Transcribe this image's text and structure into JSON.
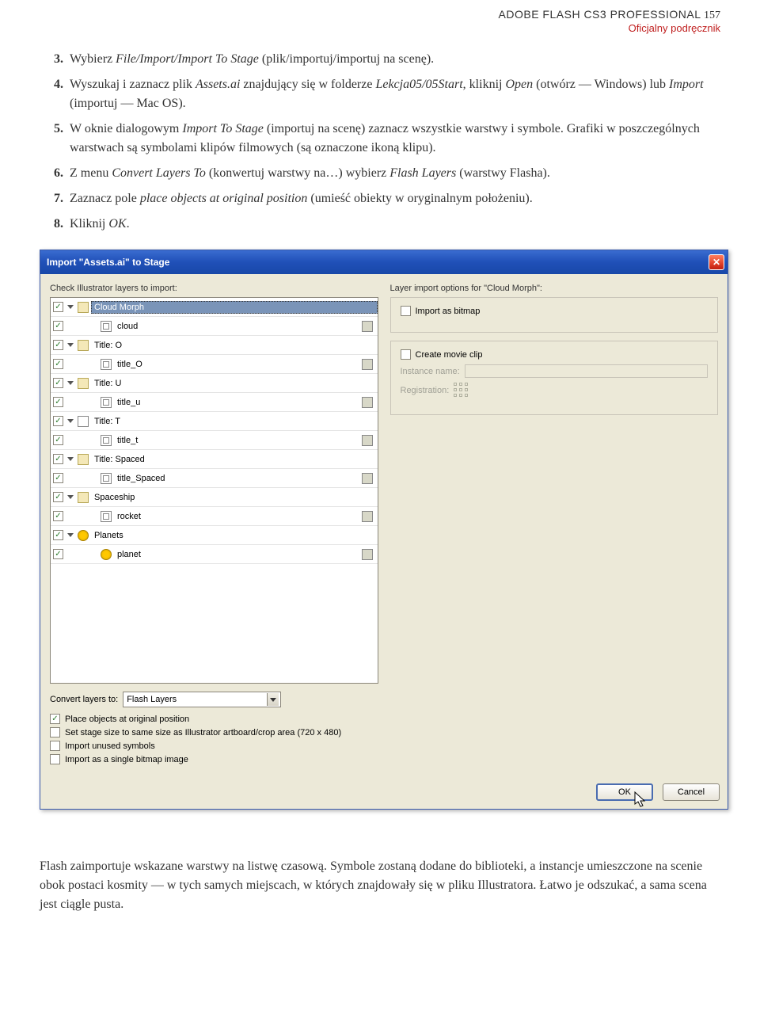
{
  "header": {
    "title": "ADOBE FLASH CS3 PROFESSIONAL",
    "page_num": "157",
    "subtitle": "Oficjalny podręcznik"
  },
  "steps": [
    {
      "n": "3.",
      "pre": "Wybierz ",
      "i": "File/Import/Import To Stage",
      "post": " (plik/importuj/importuj na scenę)."
    },
    {
      "n": "4.",
      "pre": "Wyszukaj i zaznacz plik ",
      "i": "Assets.ai",
      "post": " znajdujący się w folderze ",
      "i2": "Lekcja05/05Start",
      "post2": ", kliknij ",
      "i3": "Open",
      "post3": " (otwórz — Windows) lub ",
      "i4": "Import",
      "post4": " (importuj — Mac OS)."
    },
    {
      "n": "5.",
      "pre": "W oknie dialogowym ",
      "i": "Import To Stage",
      "post": " (importuj na scenę) zaznacz wszystkie warstwy i symbole. Grafiki w poszczególnych warstwach są symbolami klipów filmowych (są oznaczone ikoną klipu)."
    },
    {
      "n": "6.",
      "pre": "Z menu ",
      "i": "Convert Layers To",
      "post": " (konwertuj warstwy na…) wybierz ",
      "i2": "Flash Layers",
      "post2": " (warstwy Flasha)."
    },
    {
      "n": "7.",
      "pre": "Zaznacz pole ",
      "i": "place objects at original position",
      "post": " (umieść obiekty w oryginalnym położeniu)."
    },
    {
      "n": "8.",
      "pre": "Kliknij ",
      "i": "OK",
      "post": "."
    }
  ],
  "dialog": {
    "title": "Import \"Assets.ai\" to Stage",
    "left_label": "Check Illustrator layers to import:",
    "right_label": "Layer import options for \"Cloud Morph\":",
    "layers": [
      {
        "indent": 0,
        "selected": true,
        "icon": "folder",
        "label": "Cloud Morph",
        "type": null,
        "tri": true
      },
      {
        "indent": 1,
        "selected": false,
        "icon": "clip",
        "label": "cloud",
        "type": "bmp",
        "tri": false
      },
      {
        "indent": 0,
        "selected": false,
        "icon": "folder",
        "label": "Title: O",
        "type": null,
        "tri": true
      },
      {
        "indent": 1,
        "selected": false,
        "icon": "clip",
        "label": "title_O",
        "type": "bmp",
        "tri": false
      },
      {
        "indent": 0,
        "selected": false,
        "icon": "folder",
        "label": "Title: U",
        "type": null,
        "tri": true
      },
      {
        "indent": 1,
        "selected": false,
        "icon": "clip",
        "label": "title_u",
        "type": "bmp",
        "tri": false
      },
      {
        "indent": 0,
        "selected": false,
        "icon": "group",
        "label": "Title: T",
        "type": null,
        "tri": true
      },
      {
        "indent": 1,
        "selected": false,
        "icon": "clip",
        "label": "title_t",
        "type": "bmp",
        "tri": false
      },
      {
        "indent": 0,
        "selected": false,
        "icon": "folder",
        "label": "Title: Spaced",
        "type": null,
        "tri": true
      },
      {
        "indent": 1,
        "selected": false,
        "icon": "clip",
        "label": "title_Spaced",
        "type": "bmp",
        "tri": false
      },
      {
        "indent": 0,
        "selected": false,
        "icon": "folder",
        "label": "Spaceship",
        "type": null,
        "tri": true
      },
      {
        "indent": 1,
        "selected": false,
        "icon": "clip",
        "label": "rocket",
        "type": "bmp",
        "tri": false
      },
      {
        "indent": 0,
        "selected": false,
        "icon": "circle-y",
        "label": "Planets",
        "type": null,
        "tri": true
      },
      {
        "indent": 1,
        "selected": false,
        "icon": "circle-y",
        "label": "planet",
        "type": "bmp",
        "tri": false
      }
    ],
    "right": {
      "import_bitmap": "Import as bitmap",
      "create_clip": "Create movie clip",
      "instance_label": "Instance name:",
      "registration_label": "Registration:"
    },
    "convert_label": "Convert layers to:",
    "convert_value": "Flash Layers",
    "options": [
      {
        "checked": true,
        "label": "Place objects at original position"
      },
      {
        "checked": false,
        "label": "Set stage size to same size as Illustrator artboard/crop area (720 x 480)"
      },
      {
        "checked": false,
        "label": "Import unused symbols"
      },
      {
        "checked": false,
        "label": "Import as a single bitmap image"
      }
    ],
    "ok": "OK",
    "cancel": "Cancel"
  },
  "footer": "Flash zaimportuje wskazane warstwy na listwę czasową. Symbole zostaną dodane do biblioteki, a instancje umieszczone na scenie obok postaci kosmity — w tych samych miejscach, w których znajdowały się w pliku Illustratora. Łatwo je odszukać, a sama scena jest ciągle pusta."
}
